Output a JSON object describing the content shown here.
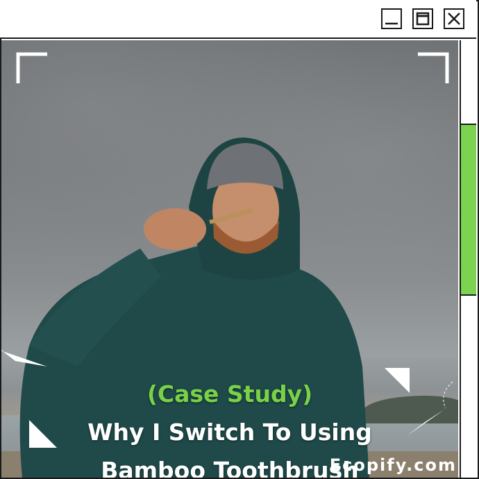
{
  "window": {
    "controls": [
      "minimize",
      "maximize",
      "close"
    ]
  },
  "photo": {
    "subject": "man in green rain jacket brushing teeth with bamboo toothbrush on a beach"
  },
  "caption": {
    "line1": "(Case Study)",
    "line2": "Why I Switch To Using",
    "line3": "Bamboo Toothbrush"
  },
  "brand": "Ecopify.com",
  "colors": {
    "accent": "#7cd34f",
    "frame": "#1a1a1a",
    "text": "#ffffff"
  },
  "scrollbar": {
    "thumb_fraction": 0.39,
    "thumb_start_fraction": 0.19
  }
}
